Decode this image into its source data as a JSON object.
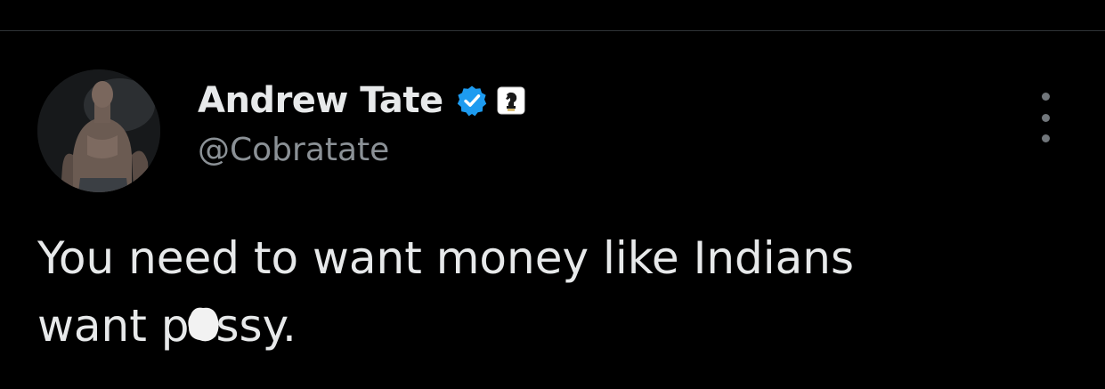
{
  "tweet": {
    "author": {
      "display_name": "Andrew Tate",
      "handle": "@Cobratate",
      "avatar": "avatar-photo",
      "badges": [
        "verified-badge-icon",
        "affiliate-knight-icon"
      ]
    },
    "text_line_1": "You need to want money like Indians",
    "text_line_2_prefix": "want p",
    "text_line_2_suffix": "ssy.",
    "more_icon": "more-options-icon"
  },
  "colors": {
    "background": "#000000",
    "text": "#e7e9ea",
    "secondary_text": "#8b9196",
    "verified_blue": "#1d9bf0",
    "divider": "#2f3336"
  }
}
